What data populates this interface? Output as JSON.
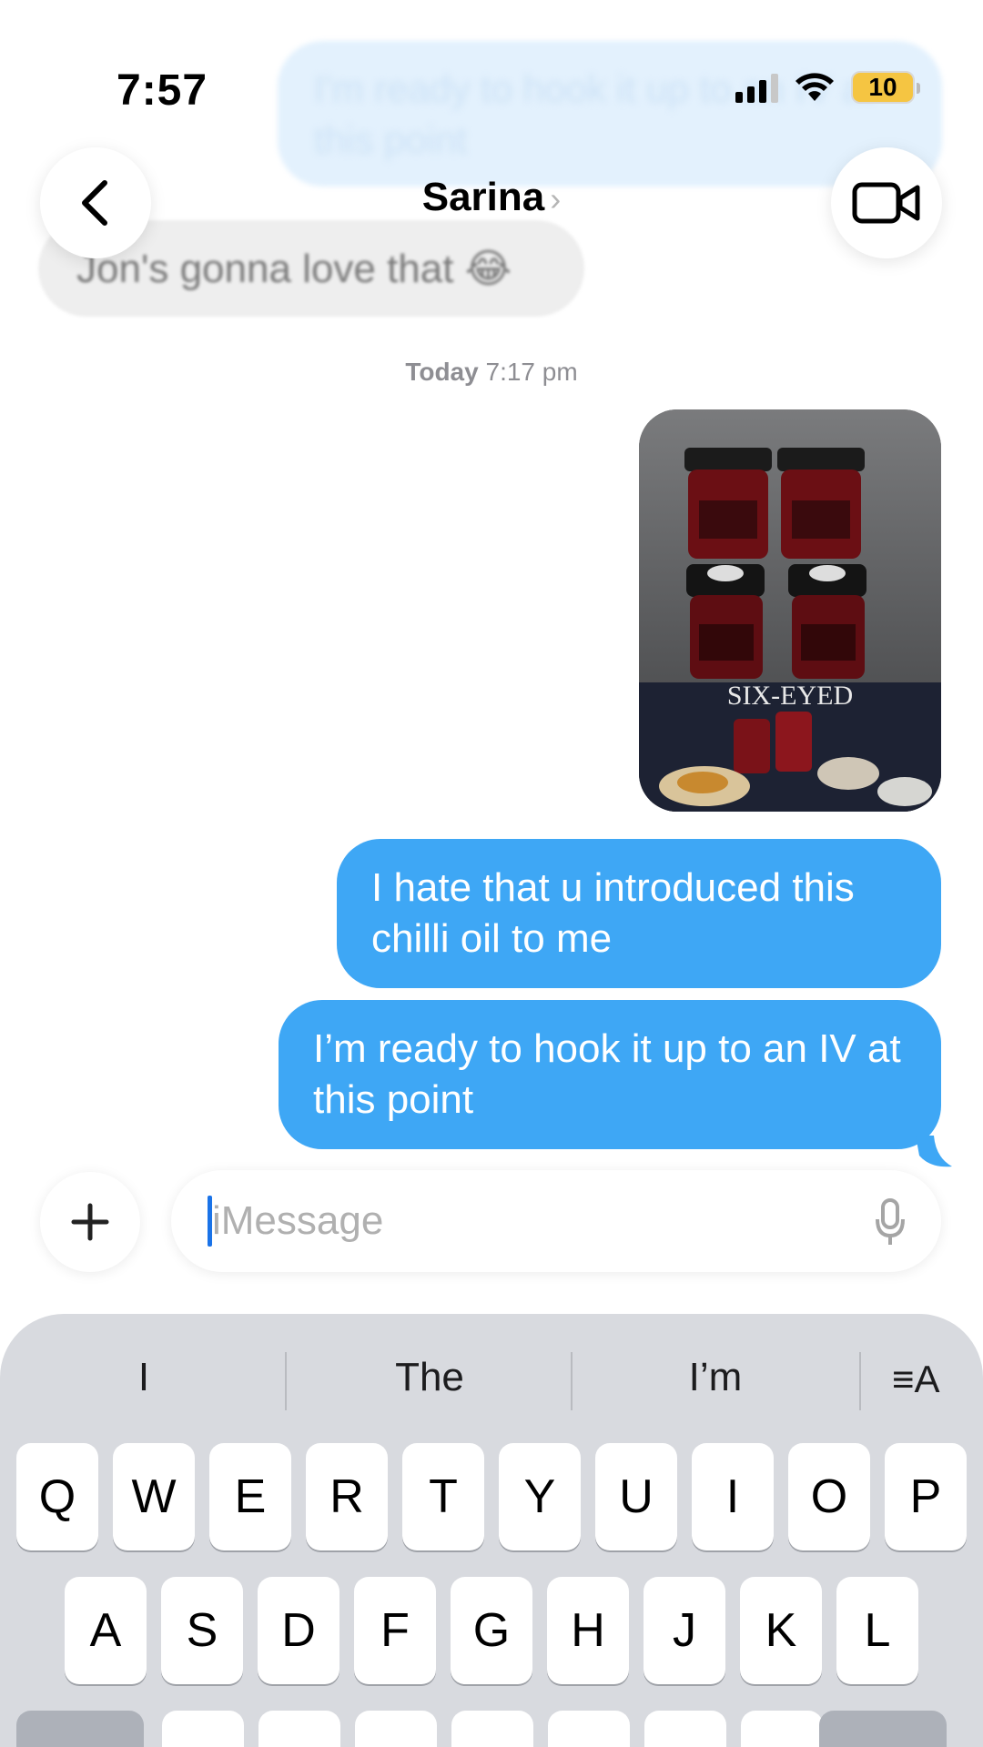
{
  "status_bar": {
    "time": "7:57",
    "battery": "10"
  },
  "background_messages": {
    "blue_partial": "I'm ready to hook it up to an IV at this point",
    "gray": "Jon's gonna love that 😂"
  },
  "header": {
    "contact_name": "Sarina",
    "chevron": "›"
  },
  "thread": {
    "timestamp_day": "Today",
    "timestamp_time": "7:17 pm",
    "photo_text": "SIX-EYED",
    "messages": [
      {
        "text": "I hate that u introduced this chilli oil to me"
      },
      {
        "text": "I’m ready to hook it up to an IV at this point"
      }
    ]
  },
  "input": {
    "placeholder": "iMessage"
  },
  "keyboard": {
    "predictions": [
      "I",
      "The",
      "I’m"
    ],
    "format_label": "≡A",
    "row1": [
      "Q",
      "W",
      "E",
      "R",
      "T",
      "Y",
      "U",
      "I",
      "O",
      "P"
    ],
    "row2": [
      "A",
      "S",
      "D",
      "F",
      "G",
      "H",
      "J",
      "K",
      "L"
    ]
  },
  "colors": {
    "bubble_blue": "#3ea7f5",
    "keyboard_bg": "#d8dadf",
    "battery_yellow": "#f5c542"
  }
}
